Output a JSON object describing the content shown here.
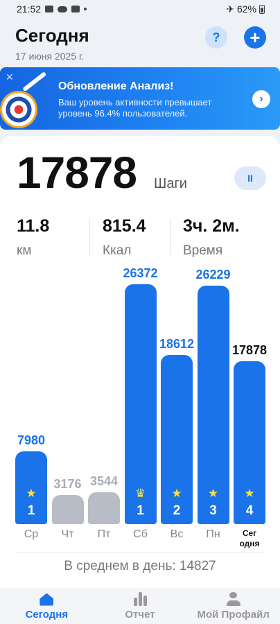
{
  "status_bar": {
    "time": "21:52",
    "battery": "62%"
  },
  "header": {
    "title": "Сегодня",
    "date": "17 июня 2025 г.",
    "help_icon_label": "?",
    "add_icon_label": "+"
  },
  "banner": {
    "title": "Обновление Анализ!",
    "text": "Ваш уровень активности превышает уровень 96.4% пользователей.",
    "close_label": "✕",
    "arrow_label": "›"
  },
  "summary": {
    "steps": "17878",
    "steps_unit": "Шаги",
    "pause_label": "II",
    "stats": [
      {
        "value": "11.8",
        "label": "км"
      },
      {
        "value": "815.4",
        "label": "Ккал"
      },
      {
        "value": "3ч. 2м.",
        "label": "Время"
      }
    ]
  },
  "chart_data": {
    "type": "bar",
    "categories": [
      "Ср",
      "Чт",
      "Пт",
      "Сб",
      "Вс",
      "Пн",
      "Сег одня"
    ],
    "values": [
      7980,
      3176,
      3544,
      26372,
      18612,
      26229,
      17878
    ],
    "value_labels": [
      "7980",
      "3176",
      "3544",
      "26372",
      "18612",
      "26229",
      "17878"
    ],
    "ranks": [
      "1",
      "",
      "",
      "1",
      "2",
      "3",
      "4"
    ],
    "markers": [
      "star",
      "",
      "",
      "crown",
      "star",
      "star",
      "star"
    ],
    "goal_met": [
      true,
      false,
      false,
      true,
      true,
      true,
      true
    ],
    "today_label_lines": [
      "Сег",
      "одня"
    ],
    "colors": {
      "goal": "#1a73e8",
      "below": "#b7bcc6",
      "today_value": "#111111",
      "value": "#1a73e8",
      "below_value": "#a9adb5"
    }
  },
  "average": "В среднем в день: 14827",
  "nav": [
    {
      "label": "Сегодня",
      "icon": "home-icon",
      "active": true
    },
    {
      "label": "Отчет",
      "icon": "chart-icon",
      "active": false
    },
    {
      "label": "Мой Профайл",
      "icon": "profile-icon",
      "active": false
    }
  ]
}
